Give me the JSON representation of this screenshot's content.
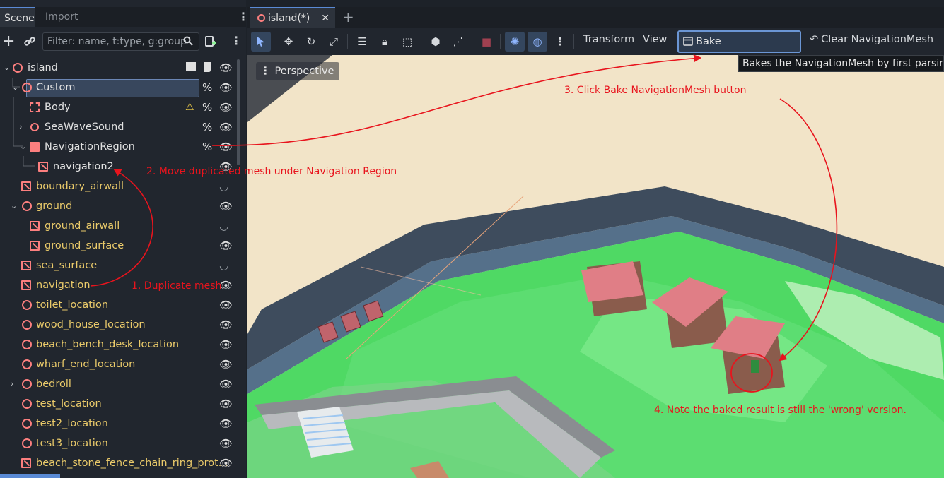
{
  "scene_dock": {
    "tabs": [
      "Scene",
      "Import"
    ],
    "filter_placeholder": "Filter: name, t:type, g:group",
    "nodes": [
      {
        "name": "island",
        "icon": "node3d-icon"
      },
      {
        "name": "Custom",
        "icon": "node3d-icon"
      },
      {
        "name": "Body",
        "icon": "static-body-icon"
      },
      {
        "name": "SeaWaveSound",
        "icon": "audio-player-icon"
      },
      {
        "name": "NavigationRegion",
        "icon": "navigation-region-icon"
      },
      {
        "name": "navigation2",
        "icon": "mesh-instance-icon"
      },
      {
        "name": "boundary_airwall",
        "icon": "mesh-instance-icon"
      },
      {
        "name": "ground",
        "icon": "node3d-icon"
      },
      {
        "name": "ground_airwall",
        "icon": "mesh-instance-icon"
      },
      {
        "name": "ground_surface",
        "icon": "mesh-instance-icon"
      },
      {
        "name": "sea_surface",
        "icon": "mesh-instance-icon"
      },
      {
        "name": "navigation",
        "icon": "mesh-instance-icon"
      },
      {
        "name": "toilet_location",
        "icon": "node3d-icon"
      },
      {
        "name": "wood_house_location",
        "icon": "node3d-icon"
      },
      {
        "name": "beach_bench_desk_location",
        "icon": "node3d-icon"
      },
      {
        "name": "wharf_end_location",
        "icon": "node3d-icon"
      },
      {
        "name": "bedroll",
        "icon": "node3d-icon"
      },
      {
        "name": "test_location",
        "icon": "node3d-icon"
      },
      {
        "name": "test2_location",
        "icon": "node3d-icon"
      },
      {
        "name": "test3_location",
        "icon": "node3d-icon"
      },
      {
        "name": "beach_stone_fence_chain_ring_prot...",
        "icon": "mesh-instance-icon"
      }
    ],
    "selected_node": "NavigationRegion"
  },
  "editor": {
    "tab_title": "island(*)",
    "menus": {
      "transform": "Transform",
      "view": "View"
    },
    "bake_button": "Bake NavigationMesh",
    "clear_button": "Clear NavigationMesh",
    "viewport_label": "Perspective",
    "tooltip": "Bakes the NavigationMesh by first parsing t"
  },
  "annotations": {
    "step1": "1. Duplicate mesh",
    "step2": "2. Move duplicated mesh under Navigation Region",
    "step3": "3. Click Bake NavigationMesh button",
    "step4": "4. Note the baked result is still the 'wrong' version."
  },
  "colors": {
    "annotation": "#e8141d",
    "accent": "#5a8ad5",
    "node_icon": "#fc7f7f",
    "navmesh_green": "#4fd964"
  }
}
